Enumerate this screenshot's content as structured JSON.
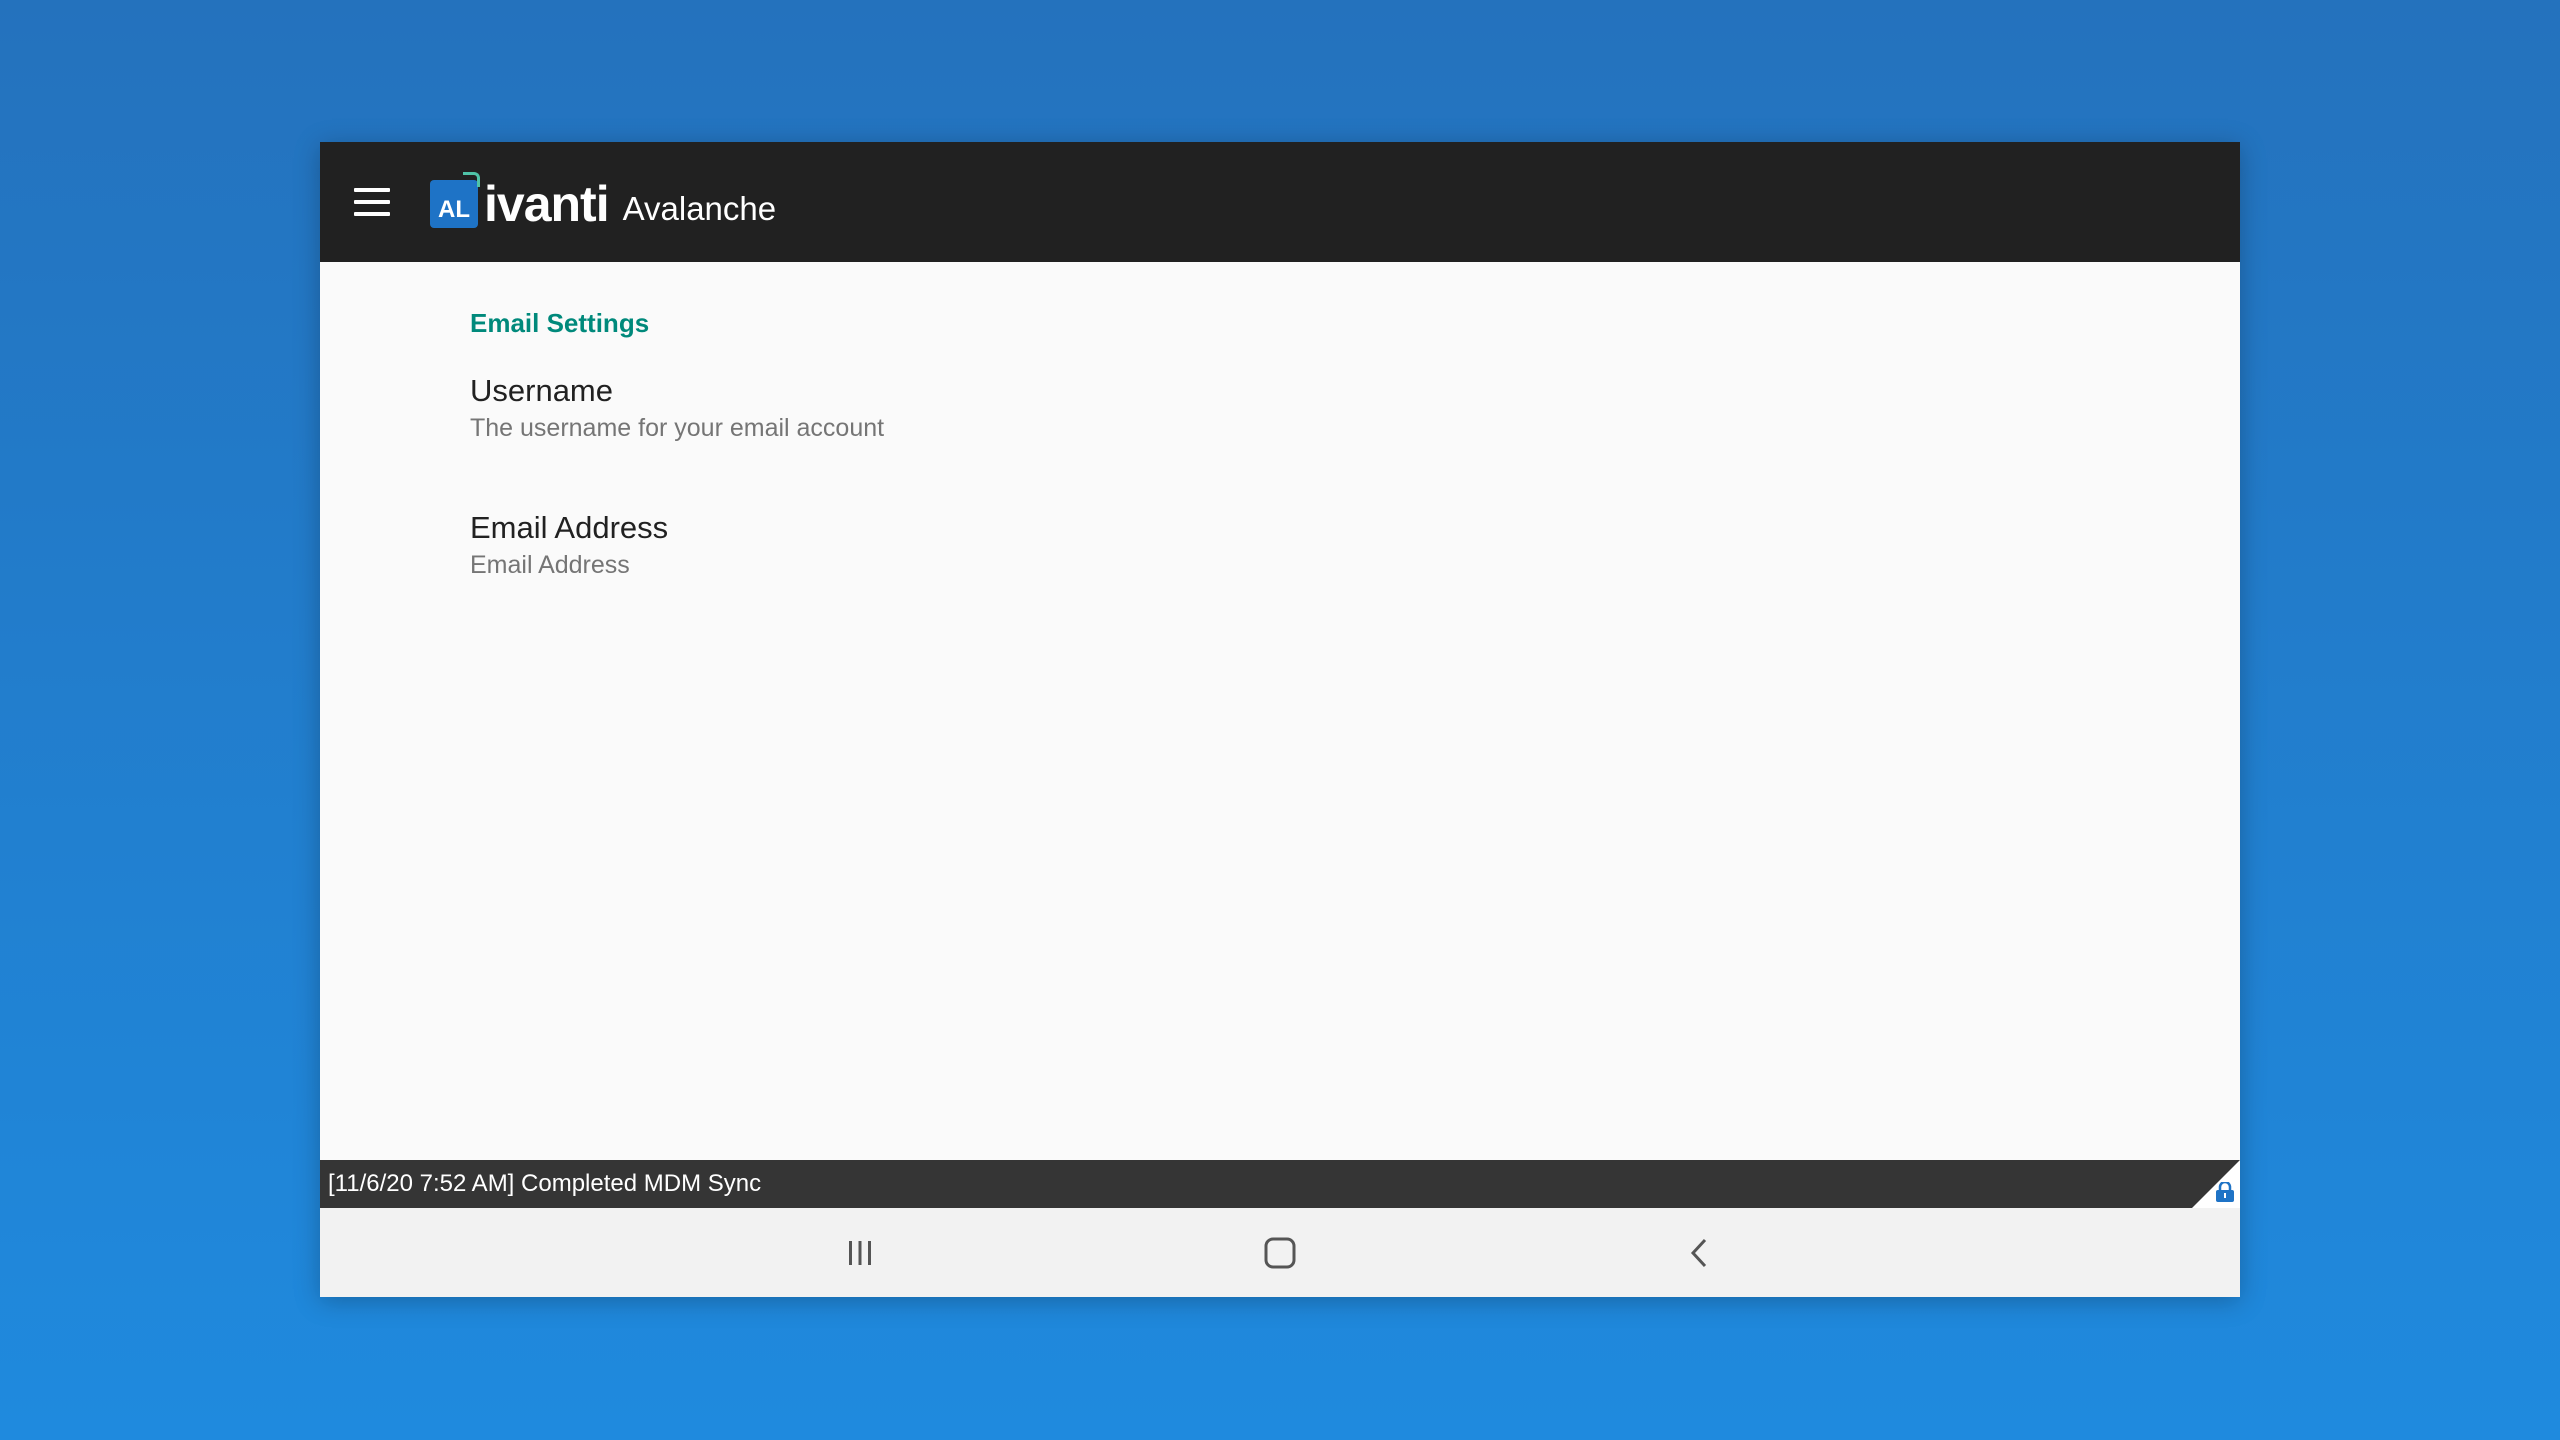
{
  "app": {
    "logo_badge": "AL",
    "brand": "ivanti",
    "product": "Avalanche"
  },
  "appbar": {
    "menu_icon": "hamburger-menu-icon"
  },
  "settings": {
    "category": "Email Settings",
    "items": [
      {
        "title": "Username",
        "summary": "The username for your email account"
      },
      {
        "title": "Email Address",
        "summary": "Email Address"
      }
    ]
  },
  "status": {
    "message": "[11/6/20 7:52 AM] Completed MDM Sync",
    "icon": "lock-icon"
  },
  "navigation": {
    "recents_icon": "recents-icon",
    "home_icon": "home-icon",
    "back_icon": "back-icon"
  },
  "colors": {
    "appbar": "#212121",
    "accent": "#00897b",
    "background": "#1f8ade"
  }
}
